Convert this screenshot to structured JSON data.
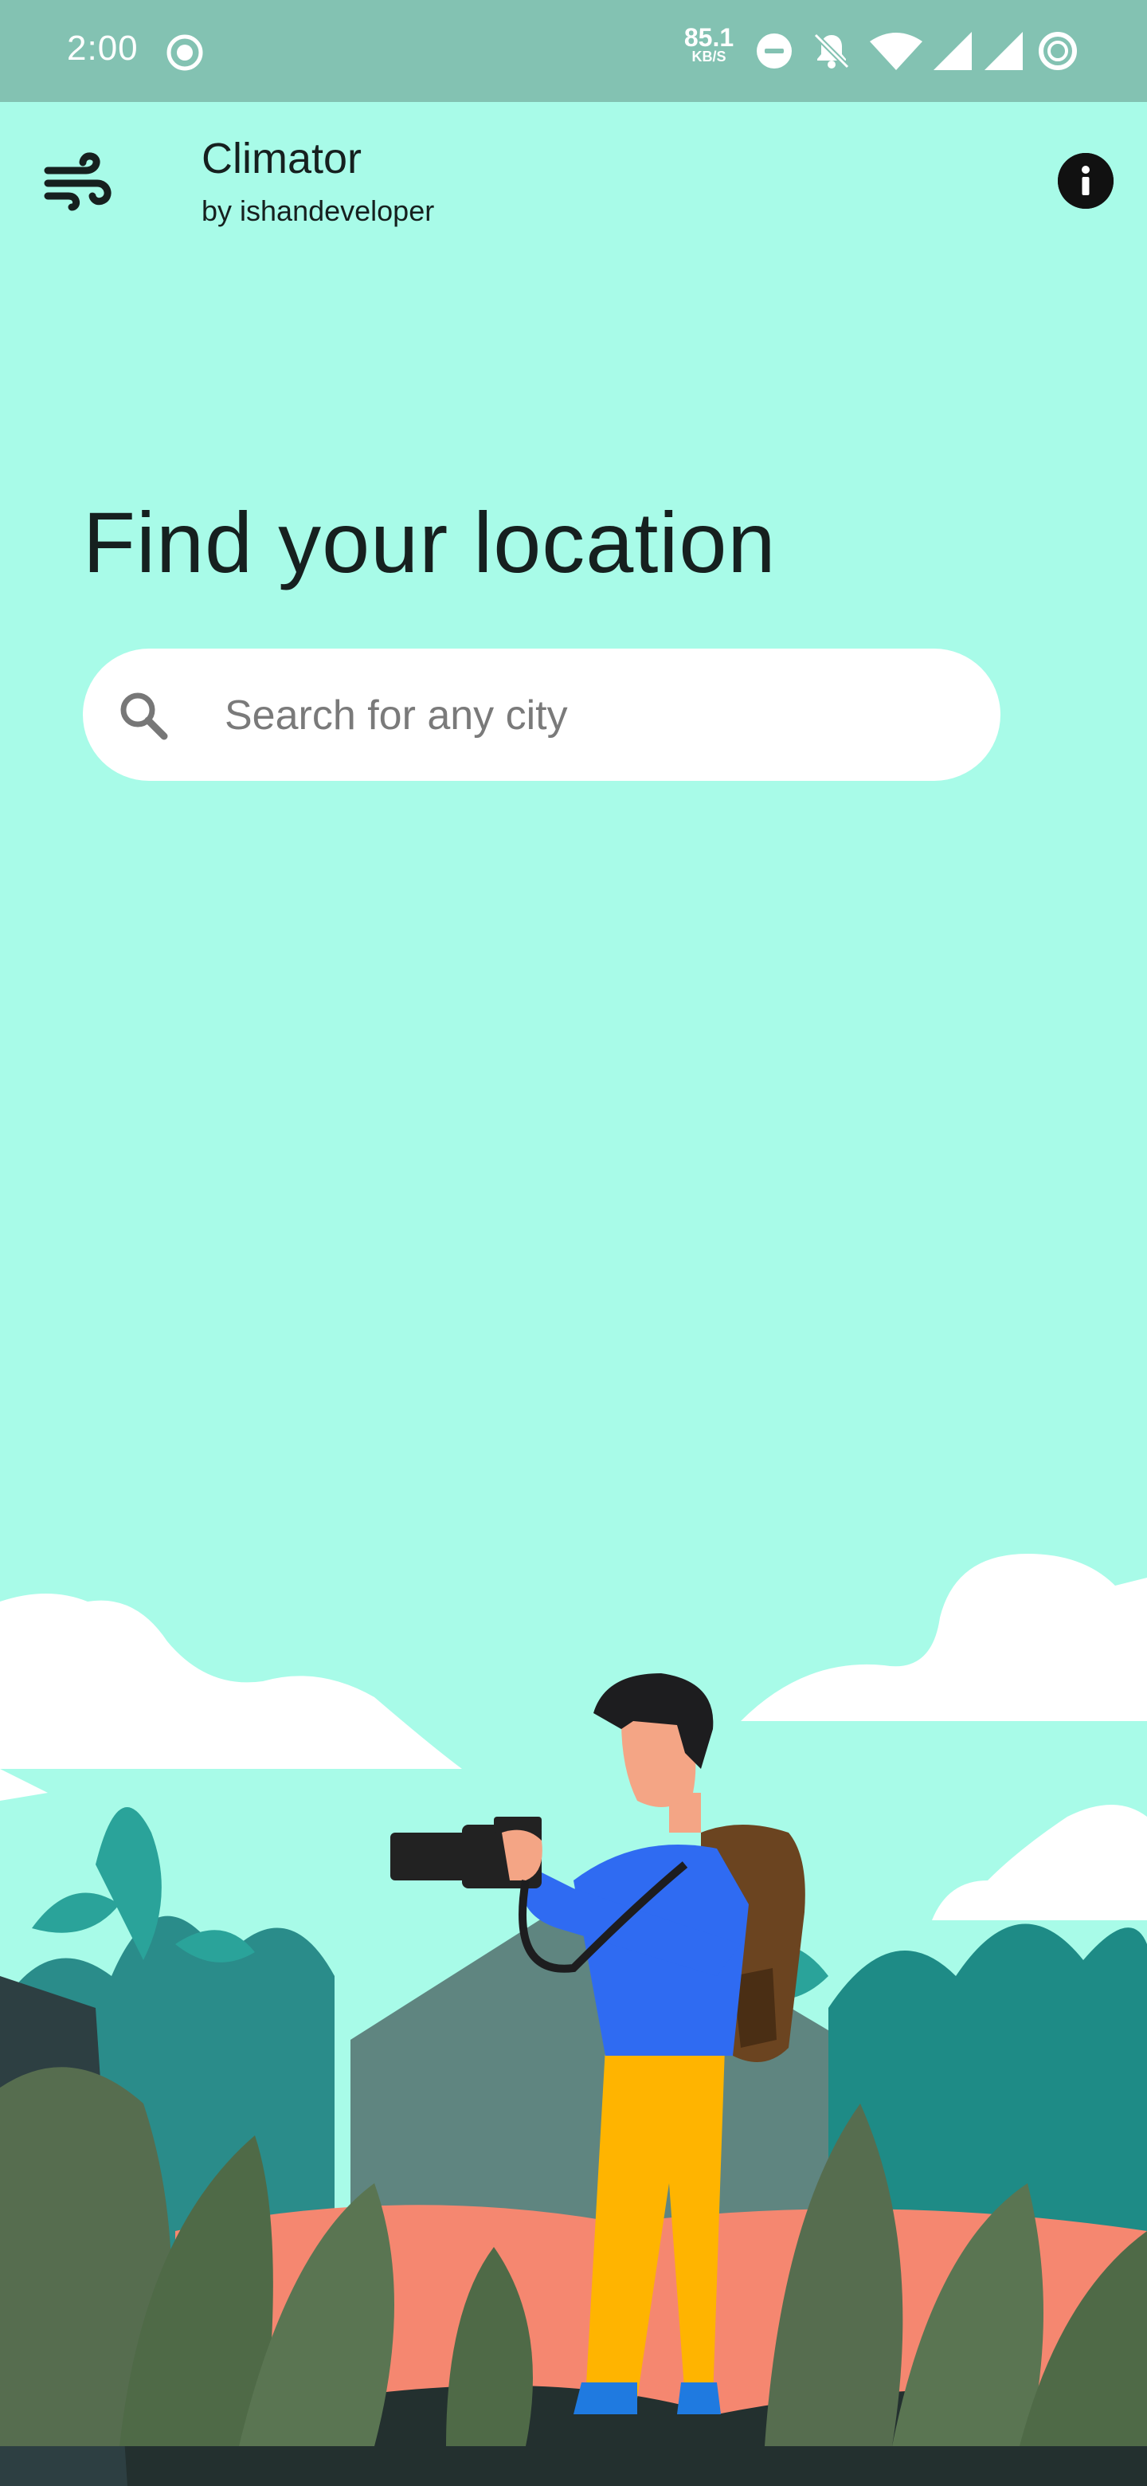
{
  "status_bar": {
    "time": "2:00",
    "net_speed_value": "85.1",
    "net_speed_unit": "KB/S",
    "icons": [
      "record-dot-icon",
      "do-not-disturb-icon",
      "bell-muted-icon",
      "wifi-icon",
      "signal-icon",
      "signal-icon",
      "battery-saver-ring-icon"
    ]
  },
  "header": {
    "logo_icon": "wind-icon",
    "title": "Climator",
    "subtitle": "by ishandeveloper",
    "info_icon": "info-icon"
  },
  "main": {
    "heading": "Find your location",
    "search": {
      "placeholder": "Search for any city",
      "value": ""
    }
  },
  "illustration": {
    "description_icon": "photographer-landscape-illustration"
  },
  "colors": {
    "background": "#a8fbe8",
    "status_bar": "#83c2b2",
    "text": "#16201f",
    "search_bg": "#ffffff"
  }
}
